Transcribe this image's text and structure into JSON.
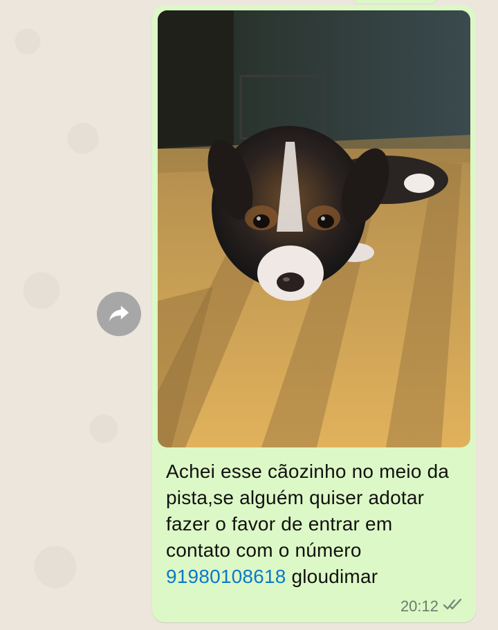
{
  "message": {
    "caption_text": "Achei esse cãozinho no meio da pista,se alguém quiser adotar fazer o favor de entrar em contato com o número",
    "phone_number": "91980108618",
    "caption_suffix": "gloudimar",
    "timestamp": "20:12",
    "status_icon": "double-check-icon",
    "image_description_icon": "photo-image",
    "bubble_color": "#dcf8c6",
    "link_color": "#0b79c9"
  },
  "actions": {
    "forward_icon": "forward-icon"
  }
}
